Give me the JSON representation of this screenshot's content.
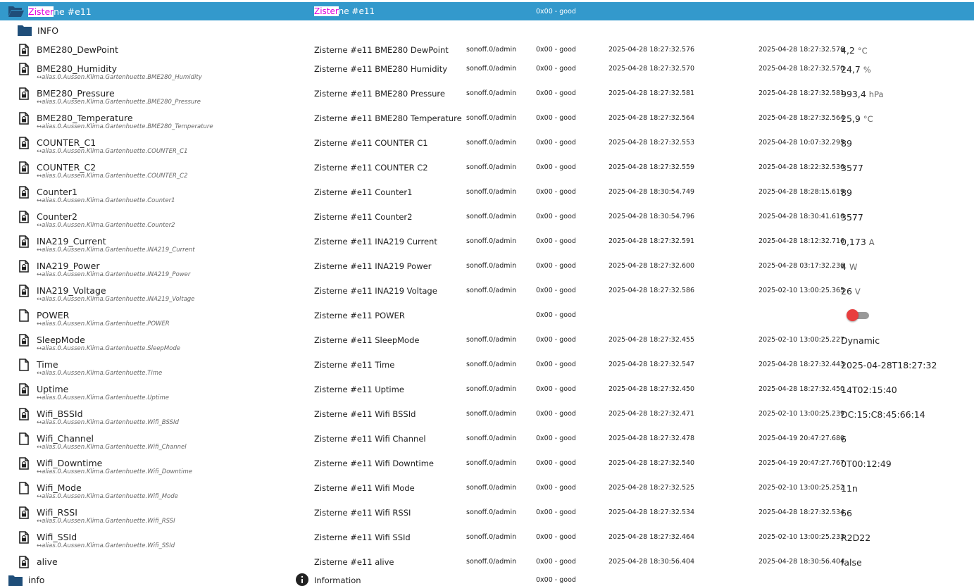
{
  "header": {
    "name_hl": "Zister",
    "name_rest": "ne #e11",
    "text_hl": "Zister",
    "text_rest": "ne #e11",
    "status": "0x00 - good"
  },
  "info_folder": {
    "name": "INFO"
  },
  "rows": [
    {
      "name": "BME280_DewPoint",
      "alias": "",
      "text": "Zisterne #e11 BME280 DewPoint",
      "role": "sonoff.0/admin",
      "status": "0x00 - good",
      "ts": "2025-04-28 18:27:32.576",
      "lc": "2025-04-28 18:27:32.576",
      "value": "4,2",
      "unit": "°C",
      "icon": "file-lock-icon"
    },
    {
      "name": "BME280_Humidity",
      "alias": "↔alias.0.Aussen.Klima.Gartenhuette.BME280_Humidity",
      "text": "Zisterne #e11 BME280 Humidity",
      "role": "sonoff.0/admin",
      "status": "0x00 - good",
      "ts": "2025-04-28 18:27:32.570",
      "lc": "2025-04-28 18:27:32.570",
      "value": "24,7",
      "unit": "%",
      "icon": "file-lock-icon"
    },
    {
      "name": "BME280_Pressure",
      "alias": "↔alias.0.Aussen.Klima.Gartenhuette.BME280_Pressure",
      "text": "Zisterne #e11 BME280 Pressure",
      "role": "sonoff.0/admin",
      "status": "0x00 - good",
      "ts": "2025-04-28 18:27:32.581",
      "lc": "2025-04-28 18:27:32.581",
      "value": "993,4",
      "unit": "hPa",
      "icon": "file-lock-icon"
    },
    {
      "name": "BME280_Temperature",
      "alias": "↔alias.0.Aussen.Klima.Gartenhuette.BME280_Temperature",
      "text": "Zisterne #e11 BME280 Temperature",
      "role": "sonoff.0/admin",
      "status": "0x00 - good",
      "ts": "2025-04-28 18:27:32.564",
      "lc": "2025-04-28 18:27:32.564",
      "value": "25,9",
      "unit": "°C",
      "icon": "file-lock-icon"
    },
    {
      "name": "COUNTER_C1",
      "alias": "↔alias.0.Aussen.Klima.Gartenhuette.COUNTER_C1",
      "text": "Zisterne #e11 COUNTER C1",
      "role": "sonoff.0/admin",
      "status": "0x00 - good",
      "ts": "2025-04-28 18:27:32.553",
      "lc": "2025-04-28 10:07:32.295",
      "value": "89",
      "unit": "",
      "icon": "file-lock-icon"
    },
    {
      "name": "COUNTER_C2",
      "alias": "↔alias.0.Aussen.Klima.Gartenhuette.COUNTER_C2",
      "text": "Zisterne #e11 COUNTER C2",
      "role": "sonoff.0/admin",
      "status": "0x00 - good",
      "ts": "2025-04-28 18:27:32.559",
      "lc": "2025-04-28 18:22:32.536",
      "value": "3577",
      "unit": "",
      "icon": "file-lock-icon"
    },
    {
      "name": "Counter1",
      "alias": "↔alias.0.Aussen.Klima.Gartenhuette.Counter1",
      "text": "Zisterne #e11 Counter1",
      "role": "sonoff.0/admin",
      "status": "0x00 - good",
      "ts": "2025-04-28 18:30:54.749",
      "lc": "2025-04-28 18:28:15.619",
      "value": "89",
      "unit": "",
      "icon": "file-lock-icon"
    },
    {
      "name": "Counter2",
      "alias": "↔alias.0.Aussen.Klima.Gartenhuette.Counter2",
      "text": "Zisterne #e11 Counter2",
      "role": "sonoff.0/admin",
      "status": "0x00 - good",
      "ts": "2025-04-28 18:30:54.796",
      "lc": "2025-04-28 18:30:41.616",
      "value": "3577",
      "unit": "",
      "icon": "file-lock-icon"
    },
    {
      "name": "INA219_Current",
      "alias": "↔alias.0.Aussen.Klima.Gartenhuette.INA219_Current",
      "text": "Zisterne #e11 INA219 Current",
      "role": "sonoff.0/admin",
      "status": "0x00 - good",
      "ts": "2025-04-28 18:27:32.591",
      "lc": "2025-04-28 18:12:32.716",
      "value": "0,173",
      "unit": "A",
      "icon": "file-lock-icon"
    },
    {
      "name": "INA219_Power",
      "alias": "↔alias.0.Aussen.Klima.Gartenhuette.INA219_Power",
      "text": "Zisterne #e11 INA219 Power",
      "role": "sonoff.0/admin",
      "status": "0x00 - good",
      "ts": "2025-04-28 18:27:32.600",
      "lc": "2025-04-28 03:17:32.236",
      "value": "4",
      "unit": "W",
      "icon": "file-lock-icon"
    },
    {
      "name": "INA219_Voltage",
      "alias": "↔alias.0.Aussen.Klima.Gartenhuette.INA219_Voltage",
      "text": "Zisterne #e11 INA219 Voltage",
      "role": "sonoff.0/admin",
      "status": "0x00 - good",
      "ts": "2025-04-28 18:27:32.586",
      "lc": "2025-02-10 13:00:25.365",
      "value": "26",
      "unit": "V",
      "icon": "file-lock-icon"
    },
    {
      "name": "POWER",
      "alias": "↔alias.0.Aussen.Klima.Gartenhuette.POWER",
      "text": "Zisterne #e11 POWER",
      "role": "",
      "status": "0x00 - good",
      "ts": "",
      "lc": "",
      "value": "",
      "unit": "",
      "icon": "file-icon",
      "toggle": false
    },
    {
      "name": "SleepMode",
      "alias": "↔alias.0.Aussen.Klima.Gartenhuette.SleepMode",
      "text": "Zisterne #e11 SleepMode",
      "role": "sonoff.0/admin",
      "status": "0x00 - good",
      "ts": "2025-04-28 18:27:32.455",
      "lc": "2025-02-10 13:00:25.227",
      "value": "Dynamic",
      "unit": "",
      "icon": "file-lock-icon"
    },
    {
      "name": "Time",
      "alias": "↔alias.0.Aussen.Klima.Gartenhuette.Time",
      "text": "Zisterne #e11 Time",
      "role": "sonoff.0/admin",
      "status": "0x00 - good",
      "ts": "2025-04-28 18:27:32.547",
      "lc": "2025-04-28 18:27:32.443",
      "value": "2025-04-28T18:27:32",
      "unit": "",
      "icon": "file-icon"
    },
    {
      "name": "Uptime",
      "alias": "↔alias.0.Aussen.Klima.Gartenhuette.Uptime",
      "text": "Zisterne #e11 Uptime",
      "role": "sonoff.0/admin",
      "status": "0x00 - good",
      "ts": "2025-04-28 18:27:32.450",
      "lc": "2025-04-28 18:27:32.450",
      "value": "14T02:15:40",
      "unit": "",
      "icon": "file-lock-icon"
    },
    {
      "name": "Wifi_BSSId",
      "alias": "↔alias.0.Aussen.Klima.Gartenhuette.Wifi_BSSId",
      "text": "Zisterne #e11 Wifi BSSId",
      "role": "sonoff.0/admin",
      "status": "0x00 - good",
      "ts": "2025-04-28 18:27:32.471",
      "lc": "2025-02-10 13:00:25.239",
      "value": "DC:15:C8:45:66:14",
      "unit": "",
      "icon": "file-lock-icon"
    },
    {
      "name": "Wifi_Channel",
      "alias": "↔alias.0.Aussen.Klima.Gartenhuette.Wifi_Channel",
      "text": "Zisterne #e11 Wifi Channel",
      "role": "sonoff.0/admin",
      "status": "0x00 - good",
      "ts": "2025-04-28 18:27:32.478",
      "lc": "2025-04-19 20:47:27.680",
      "value": "6",
      "unit": "",
      "icon": "file-icon"
    },
    {
      "name": "Wifi_Downtime",
      "alias": "↔alias.0.Aussen.Klima.Gartenhuette.Wifi_Downtime",
      "text": "Zisterne #e11 Wifi Downtime",
      "role": "sonoff.0/admin",
      "status": "0x00 - good",
      "ts": "2025-04-28 18:27:32.540",
      "lc": "2025-04-19 20:47:27.767",
      "value": "0T00:12:49",
      "unit": "",
      "icon": "file-lock-icon"
    },
    {
      "name": "Wifi_Mode",
      "alias": "↔alias.0.Aussen.Klima.Gartenhuette.Wifi_Mode",
      "text": "Zisterne #e11 Wifi Mode",
      "role": "sonoff.0/admin",
      "status": "0x00 - good",
      "ts": "2025-04-28 18:27:32.525",
      "lc": "2025-02-10 13:00:25.252",
      "value": "11n",
      "unit": "",
      "icon": "file-icon"
    },
    {
      "name": "Wifi_RSSI",
      "alias": "↔alias.0.Aussen.Klima.Gartenhuette.Wifi_RSSI",
      "text": "Zisterne #e11 Wifi RSSI",
      "role": "sonoff.0/admin",
      "status": "0x00 - good",
      "ts": "2025-04-28 18:27:32.534",
      "lc": "2025-04-28 18:27:32.534",
      "value": "66",
      "unit": "",
      "icon": "file-lock-icon"
    },
    {
      "name": "Wifi_SSId",
      "alias": "↔alias.0.Aussen.Klima.Gartenhuette.Wifi_SSId",
      "text": "Zisterne #e11 Wifi SSId",
      "role": "sonoff.0/admin",
      "status": "0x00 - good",
      "ts": "2025-04-28 18:27:32.464",
      "lc": "2025-02-10 13:00:25.233",
      "value": "R2D22",
      "unit": "",
      "icon": "file-lock-icon"
    },
    {
      "name": "alive",
      "alias": "",
      "text": "Zisterne #e11 alive",
      "role": "sonoff.0/admin",
      "status": "0x00 - good",
      "ts": "2025-04-28 18:30:56.404",
      "lc": "2025-04-28 18:30:56.404",
      "value": "false",
      "unit": "",
      "icon": "file-lock-icon"
    }
  ],
  "footer": {
    "name": "info",
    "text": "Information",
    "status": "0x00 - good"
  },
  "colors": {
    "header_bg": "#3399cc",
    "folder": "#1f4e79",
    "highlight": "#e000e0",
    "toggle_knob": "#e83e3e"
  }
}
